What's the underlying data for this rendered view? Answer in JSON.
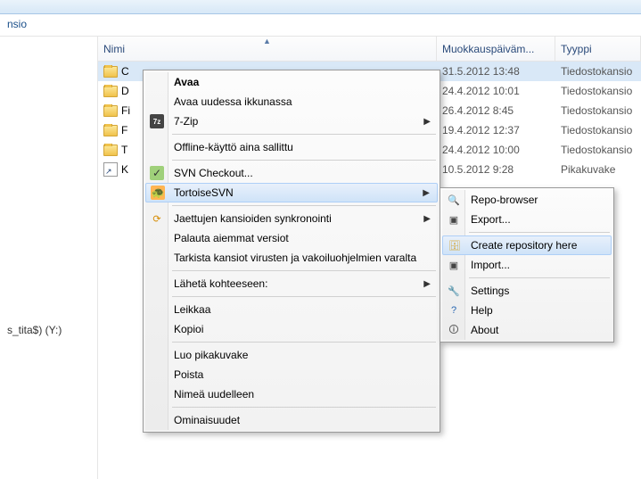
{
  "breadcrumb": "nsio",
  "columns": {
    "name": "Nimi",
    "modified": "Muokkauspäiväm...",
    "type": "Tyyppi"
  },
  "rows": [
    {
      "name": "C",
      "mod": "31.5.2012 13:48",
      "type": "Tiedostokansio",
      "icon": "folder",
      "selected": true
    },
    {
      "name": "D",
      "mod": "24.4.2012 10:01",
      "type": "Tiedostokansio",
      "icon": "folder"
    },
    {
      "name": "Fi",
      "mod": "26.4.2012 8:45",
      "type": "Tiedostokansio",
      "icon": "folder"
    },
    {
      "name": "F",
      "mod": "19.4.2012 12:37",
      "type": "Tiedostokansio",
      "icon": "folder"
    },
    {
      "name": "T",
      "mod": "24.4.2012 10:00",
      "type": "Tiedostokansio",
      "icon": "folder"
    },
    {
      "name": "K",
      "mod": "10.5.2012 9:28",
      "type": "Pikakuvake",
      "icon": "shortcut"
    }
  ],
  "sidebar": {
    "item0": "s_tita$) (Y:)"
  },
  "menu1": {
    "avaa": "Avaa",
    "avaa_uudessa": "Avaa uudessa ikkunassa",
    "seven_zip": "7-Zip",
    "offline": "Offline-käyttö aina sallittu",
    "svn_checkout": "SVN Checkout...",
    "tortoise": "TortoiseSVN",
    "jaettujen": "Jaettujen kansioiden synkronointi",
    "palauta": "Palauta aiemmat versiot",
    "tarkista": "Tarkista kansiot virusten ja vakoiluohjelmien varalta",
    "laheta": "Lähetä kohteeseen:",
    "leikkaa": "Leikkaa",
    "kopioi": "Kopioi",
    "luo": "Luo pikakuvake",
    "poista": "Poista",
    "nimea": "Nimeä uudelleen",
    "ominaisuudet": "Ominaisuudet"
  },
  "menu2": {
    "repo_browser": "Repo-browser",
    "export": "Export...",
    "create_repo": "Create repository here",
    "import": "Import...",
    "settings": "Settings",
    "help": "Help",
    "about": "About"
  }
}
